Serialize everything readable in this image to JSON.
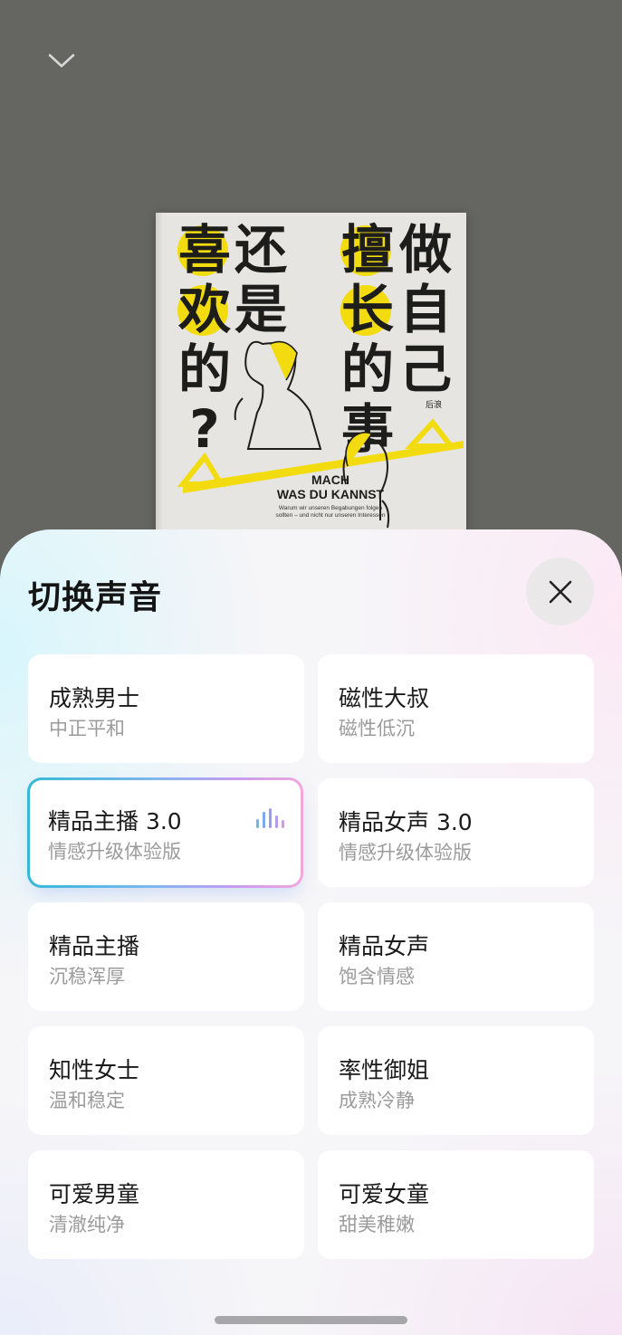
{
  "book": {
    "left_title": [
      "喜",
      "欢",
      "的",
      "?"
    ],
    "left_title2": [
      "还",
      "是"
    ],
    "right_title": [
      "擅",
      "长",
      "的",
      "事"
    ],
    "right_title2": [
      "做",
      "自",
      "己"
    ],
    "en_title_line1": "MACH",
    "en_title_line2": "WAS DU KANNST",
    "en_subtitle": "Warum wir unseren Begabungen folgen sollten – und nicht nur unseren Interessen",
    "publisher": "后浪",
    "accent_color": "#f2dc0f"
  },
  "sheet": {
    "title": "切换声音",
    "close_icon": "close-icon"
  },
  "voices": [
    {
      "name": "成熟男士",
      "desc": "中正平和",
      "selected": false
    },
    {
      "name": "磁性大叔",
      "desc": "磁性低沉",
      "selected": false
    },
    {
      "name": "精品主播 3.0",
      "desc": "情感升级体验版",
      "selected": true
    },
    {
      "name": "精品女声 3.0",
      "desc": "情感升级体验版",
      "selected": false
    },
    {
      "name": "精品主播",
      "desc": "沉稳浑厚",
      "selected": false
    },
    {
      "name": "精品女声",
      "desc": "饱含情感",
      "selected": false
    },
    {
      "name": "知性女士",
      "desc": "温和稳定",
      "selected": false
    },
    {
      "name": "率性御姐",
      "desc": "成熟冷静",
      "selected": false
    },
    {
      "name": "可爱男童",
      "desc": "清澈纯净",
      "selected": false
    },
    {
      "name": "可爱女童",
      "desc": "甜美稚嫩",
      "selected": false
    }
  ],
  "colors": {
    "selected_gradient_start": "#34b8d8",
    "selected_gradient_end": "#f0a8dc",
    "overlay": "#656562"
  }
}
